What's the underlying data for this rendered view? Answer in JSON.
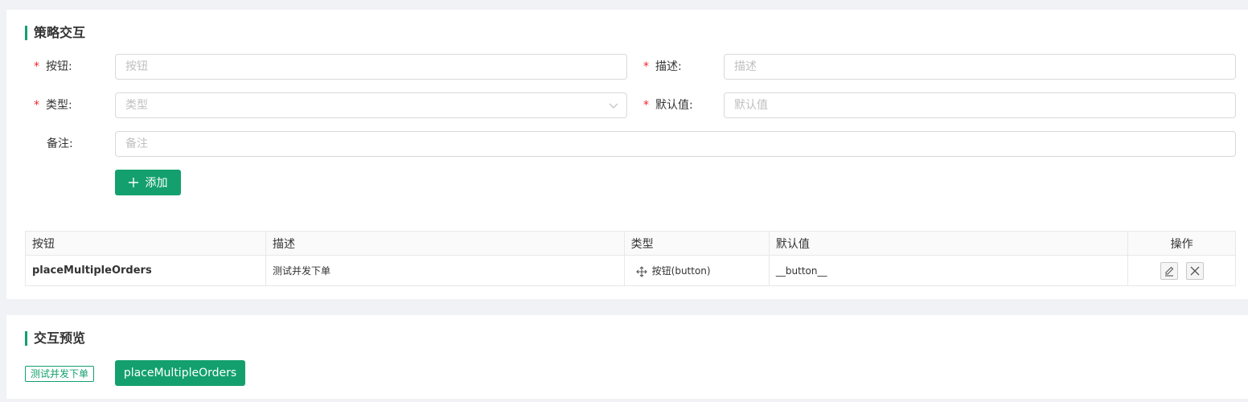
{
  "strategy": {
    "title": "策略交互",
    "form": {
      "button_label": "按钮:",
      "button_placeholder": "按钮",
      "desc_label": "描述:",
      "desc_placeholder": "描述",
      "type_label": "类型:",
      "type_placeholder": "类型",
      "default_label": "默认值:",
      "default_placeholder": "默认值",
      "note_label": "备注:",
      "note_placeholder": "备注",
      "required_mark": "*",
      "add_button": "添加"
    },
    "table": {
      "headers": [
        "按钮",
        "描述",
        "类型",
        "默认值",
        "操作"
      ],
      "rows": [
        {
          "button": "placeMultipleOrders",
          "desc": "测试并发下单",
          "type": "按钮(button)",
          "default": "__button__"
        }
      ]
    }
  },
  "preview": {
    "title": "交互预览",
    "tag": "测试并发下单",
    "button": "placeMultipleOrders"
  },
  "colors": {
    "accent": "#13a06e",
    "required": "#f5222d"
  }
}
